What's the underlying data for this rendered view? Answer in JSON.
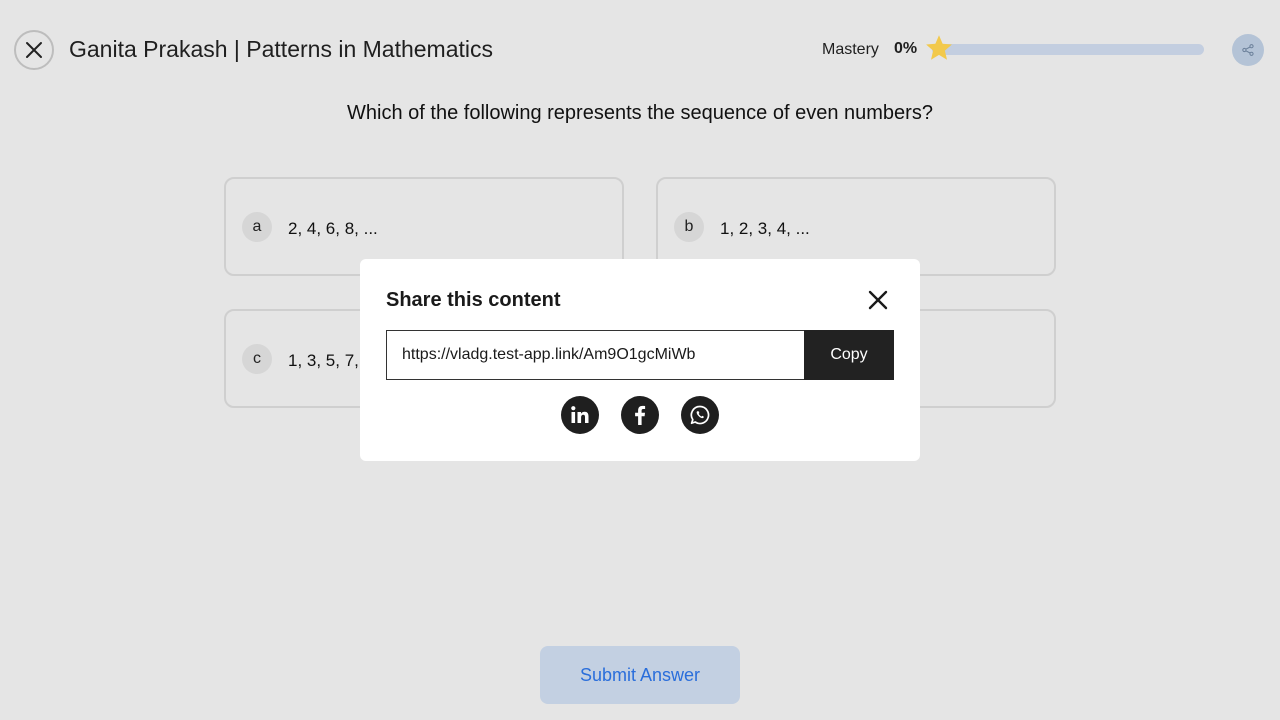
{
  "header": {
    "title": "Ganita Prakash | Patterns in Mathematics",
    "mastery_label": "Mastery",
    "mastery_value": "0%",
    "mastery_progress": 0
  },
  "question": {
    "text": "Which of the following represents the sequence of even numbers?",
    "options": [
      {
        "letter": "a",
        "text": "2, 4, 6, 8, ..."
      },
      {
        "letter": "b",
        "text": "1, 2, 3, 4, ..."
      },
      {
        "letter": "c",
        "text": "1, 3, 5, 7, ..."
      }
    ]
  },
  "submit_label": "Submit Answer",
  "modal": {
    "title": "Share this content",
    "url": "https://vladg.test-app.link/Am9O1gcMiWb",
    "copy_label": "Copy"
  },
  "icons": {
    "close": "close-icon",
    "star": "star-icon",
    "share": "share-icon",
    "linkedin": "linkedin-icon",
    "facebook": "facebook-icon",
    "whatsapp": "whatsapp-icon"
  },
  "colors": {
    "background": "#e5e5e5",
    "accent": "#2a6edb",
    "star": "#f2c94c",
    "submit_bg": "#c3d0e2"
  }
}
